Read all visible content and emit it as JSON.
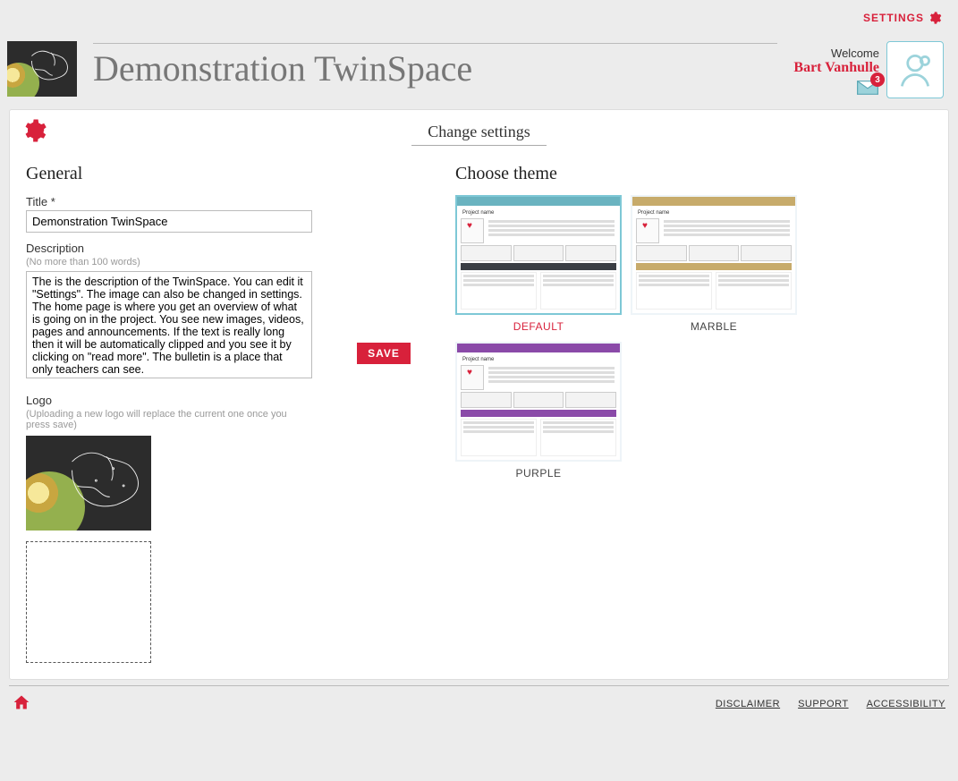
{
  "top": {
    "settings_label": "SETTINGS"
  },
  "header": {
    "title": "Demonstration TwinSpace",
    "welcome_label": "Welcome",
    "username": "Bart Vanhulle",
    "notification_count": "3"
  },
  "panel": {
    "title": "Change settings"
  },
  "general": {
    "heading": "General",
    "title_label": "Title *",
    "title_value": "Demonstration TwinSpace",
    "description_label": "Description",
    "description_hint": "(No more than 100 words)",
    "description_value": "The is the description of the TwinSpace. You can edit it \"Settings\". The image can also be changed in settings. The home page is where you get an overview of what is going on in the project. You see new images, videos, pages and announcements. If the text is really long then it will be automatically clipped and you see it by clicking on \"read more\". The bulletin is a place that only teachers can see.",
    "logo_label": "Logo",
    "logo_hint": "(Uploading a new logo will replace the current one once you press save)"
  },
  "buttons": {
    "save": "SAVE"
  },
  "themes": {
    "heading": "Choose theme",
    "options": [
      {
        "label": "DEFAULT",
        "selected": true,
        "nav_color": "#6ab3c0",
        "bar_color": "#3a3e44",
        "accent": "#d8213b"
      },
      {
        "label": "MARBLE",
        "selected": false,
        "nav_color": "#c7ab6b",
        "bar_color": "#c7ab6b",
        "accent": "#7a4ec0"
      },
      {
        "label": "PURPLE",
        "selected": false,
        "nav_color": "#8a4aa8",
        "bar_color": "#8a4aa8",
        "accent": "#8a4aa8"
      }
    ],
    "preview_project_label": "Project name"
  },
  "footer": {
    "links": [
      "DISCLAIMER",
      "SUPPORT",
      "ACCESSIBILITY"
    ]
  }
}
